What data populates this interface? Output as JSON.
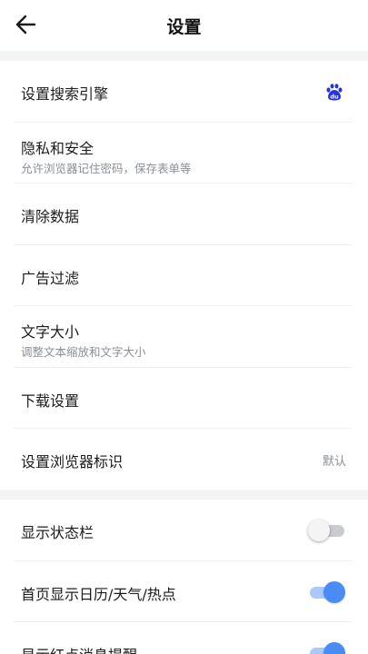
{
  "header": {
    "title": "设置",
    "back_icon": "arrow-left-icon"
  },
  "group1": {
    "items": [
      {
        "label": "设置搜索引擎",
        "icon": "baidu-icon"
      },
      {
        "label": "隐私和安全",
        "sub": "允许浏览器记住密码，保存表单等"
      },
      {
        "label": "清除数据"
      },
      {
        "label": "广告过滤"
      },
      {
        "label": "文字大小",
        "sub": "调整文本缩放和文字大小"
      },
      {
        "label": "下载设置"
      },
      {
        "label": "设置浏览器标识",
        "value": "默认"
      }
    ]
  },
  "group2": {
    "items": [
      {
        "label": "显示状态栏",
        "toggle": "off"
      },
      {
        "label": "首页显示日历/天气/热点",
        "toggle": "on"
      },
      {
        "label": "显示红点消息提醒",
        "toggle": "on"
      }
    ]
  },
  "colors": {
    "accent": "#4a8cf5",
    "accent_track": "#a9c9fb",
    "baidu_blue": "#2932e1",
    "section_gap": "#f3f4f6"
  }
}
